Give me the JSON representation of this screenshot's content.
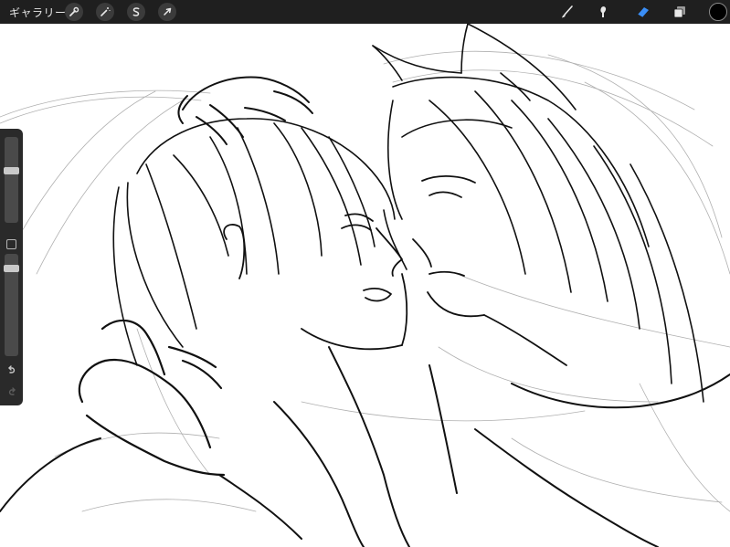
{
  "toolbar": {
    "gallery_label": "ギャラリー",
    "left_tools": [
      {
        "name": "adjustments",
        "icon": "wrench-icon"
      },
      {
        "name": "actions",
        "icon": "magic-wand-icon"
      },
      {
        "name": "selection",
        "icon": "selection-s-icon"
      },
      {
        "name": "transform",
        "icon": "arrow-cursor-icon"
      }
    ],
    "right_tools": [
      {
        "name": "brush",
        "icon": "brush-icon"
      },
      {
        "name": "smudge",
        "icon": "smudge-icon"
      },
      {
        "name": "eraser",
        "icon": "eraser-icon",
        "active": true
      },
      {
        "name": "layers",
        "icon": "layers-icon"
      }
    ],
    "current_color": "#000000",
    "active_tool_color": "#3a8ef6"
  },
  "sidebar": {
    "brush_size_level": 0.62,
    "opacity_level": 0.88,
    "undo_icon": "undo-icon",
    "redo_icon": "redo-icon",
    "modify_icon": "square-icon"
  },
  "canvas": {
    "background": "#ffffff",
    "content": "line-art-sketch"
  }
}
